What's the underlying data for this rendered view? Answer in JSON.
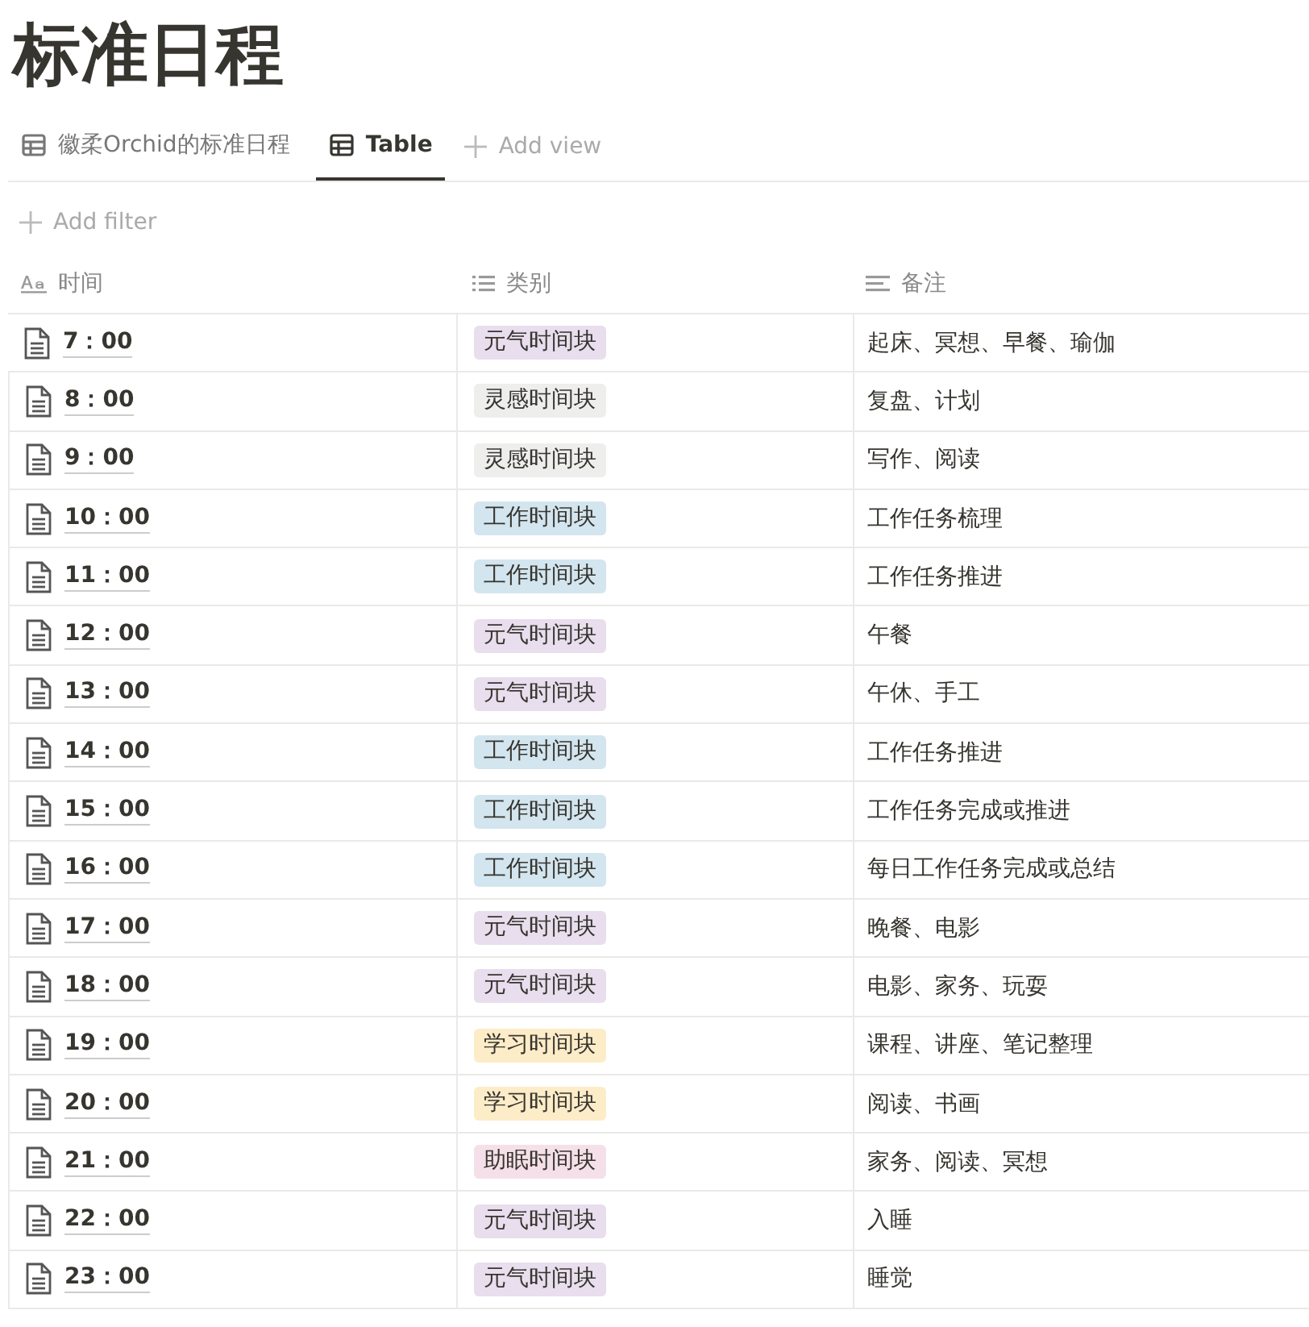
{
  "title": "标准日程",
  "tabs": [
    {
      "label": "徽柔Orchid的标准日程",
      "selected": false
    },
    {
      "label": "Table",
      "selected": true
    }
  ],
  "add_view": "Add view",
  "add_filter": "Add filter",
  "table": {
    "columns": [
      {
        "label": "时间",
        "kind": "title"
      },
      {
        "label": "类别",
        "kind": "select"
      },
      {
        "label": "备注",
        "kind": "text"
      }
    ],
    "rows": [
      {
        "time": "7：00",
        "category": "元气时间块",
        "color": "#e8deee",
        "note": "起床、冥想、早餐、瑜伽"
      },
      {
        "time": "8：00",
        "category": "灵感时间块",
        "color": "#eeeeed",
        "note": "复盘、计划"
      },
      {
        "time": "9：00",
        "category": "灵感时间块",
        "color": "#eeeeed",
        "note": "写作、阅读"
      },
      {
        "time": "10：00",
        "category": "工作时间块",
        "color": "#d3e5ef",
        "note": "工作任务梳理"
      },
      {
        "time": "11：00",
        "category": "工作时间块",
        "color": "#d3e5ef",
        "note": "工作任务推进"
      },
      {
        "time": "12：00",
        "category": "元气时间块",
        "color": "#e8deee",
        "note": "午餐"
      },
      {
        "time": "13：00",
        "category": "元气时间块",
        "color": "#e8deee",
        "note": "午休、手工"
      },
      {
        "time": "14：00",
        "category": "工作时间块",
        "color": "#d3e5ef",
        "note": "工作任务推进"
      },
      {
        "time": "15：00",
        "category": "工作时间块",
        "color": "#d3e5ef",
        "note": "工作任务完成或推进"
      },
      {
        "time": "16：00",
        "category": "工作时间块",
        "color": "#d3e5ef",
        "note": "每日工作任务完成或总结"
      },
      {
        "time": "17：00",
        "category": "元气时间块",
        "color": "#e8deee",
        "note": "晚餐、电影"
      },
      {
        "time": "18：00",
        "category": "元气时间块",
        "color": "#e8deee",
        "note": "电影、家务、玩耍"
      },
      {
        "time": "19：00",
        "category": "学习时间块",
        "color": "#fdecc8",
        "note": "课程、讲座、笔记整理"
      },
      {
        "time": "20：00",
        "category": "学习时间块",
        "color": "#fdecc8",
        "note": "阅读、书画"
      },
      {
        "time": "21：00",
        "category": "助眠时间块",
        "color": "#f5e0e9",
        "note": "家务、阅读、冥想"
      },
      {
        "time": "22：00",
        "category": "元气时间块",
        "color": "#e8deee",
        "note": "入睡"
      },
      {
        "time": "23：00",
        "category": "元气时间块",
        "color": "#e8deee",
        "note": "睡觉"
      }
    ]
  }
}
